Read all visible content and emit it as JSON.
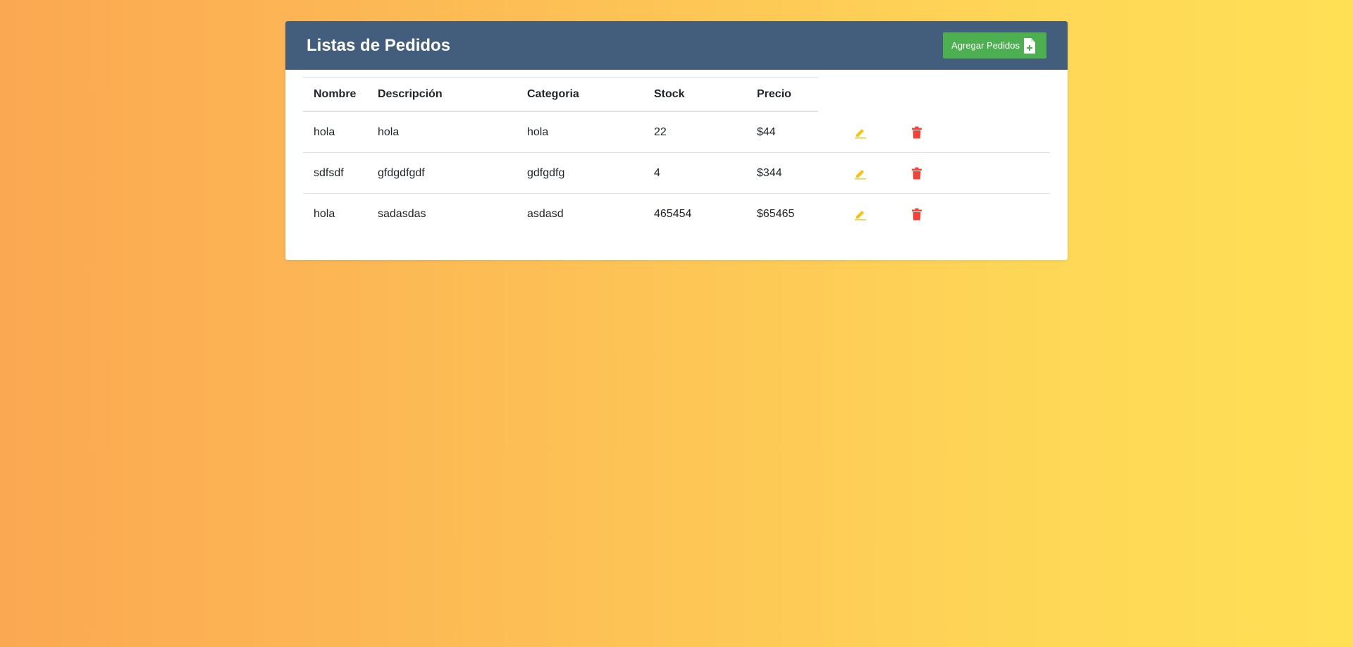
{
  "header": {
    "title": "Listas de Pedidos",
    "add_button_label": "Agregar Pedidos",
    "add_button_icon": "file-plus-icon"
  },
  "table": {
    "columns": [
      "Nombre",
      "Descripción",
      "Categoria",
      "Stock",
      "Precio"
    ],
    "rows": [
      {
        "nombre": "hola",
        "descripcion": "hola",
        "categoria": "hola",
        "stock": "22",
        "precio": "$44"
      },
      {
        "nombre": "sdfsdf",
        "descripcion": "gfdgdfgdf",
        "categoria": "gdfgdfg",
        "stock": "4",
        "precio": "$344"
      },
      {
        "nombre": "hola",
        "descripcion": "sadasdas",
        "categoria": "asdasd",
        "stock": "465454",
        "precio": "$65465"
      }
    ],
    "row_actions": {
      "edit_icon": "pencil-icon",
      "delete_icon": "trash-icon"
    }
  },
  "colors": {
    "header_bg": "#435d7d",
    "add_button_bg": "#4caf50",
    "edit_icon": "#ffc107",
    "delete_icon": "#f44336"
  }
}
